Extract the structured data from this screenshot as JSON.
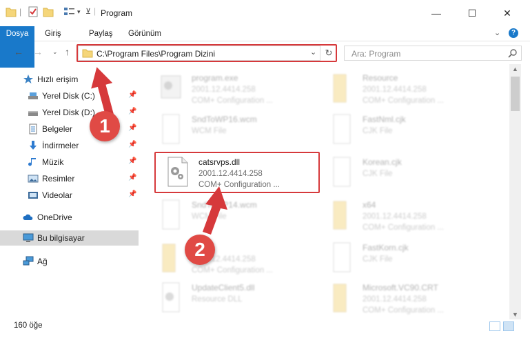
{
  "window": {
    "title": "Program",
    "controls": {
      "minimize": "—",
      "maximize": "☐",
      "close": "✕"
    }
  },
  "ribbon": {
    "tabs": [
      "Dosya",
      "Giriş",
      "Paylaş",
      "Görünüm"
    ],
    "accent": "#1979ca",
    "help_icon": "?"
  },
  "addressbar": {
    "path": "C:\\Program Files\\Program Dizini",
    "search_placeholder": "Ara: Program",
    "refresh_icon": "↻",
    "dropdown_icon": "⌄"
  },
  "sidebar": {
    "items": [
      {
        "label": "Hızlı erişim",
        "icon": "star-icon",
        "pinned": false
      },
      {
        "label": "Yerel Disk (C:)",
        "icon": "drive-icon",
        "pinned": true
      },
      {
        "label": "Yerel Disk (D:)",
        "icon": "drive-icon",
        "pinned": true
      },
      {
        "label": "Belgeler",
        "icon": "documents-icon",
        "pinned": true
      },
      {
        "label": "İndirmeler",
        "icon": "download-icon",
        "pinned": true
      },
      {
        "label": "Müzik",
        "icon": "music-icon",
        "pinned": true
      },
      {
        "label": "Resimler",
        "icon": "pictures-icon",
        "pinned": true
      },
      {
        "label": "Videolar",
        "icon": "videos-icon",
        "pinned": true
      },
      {
        "label": "OneDrive",
        "icon": "cloud-icon",
        "pinned": false
      },
      {
        "label": "Bu bilgisayar",
        "icon": "computer-icon",
        "pinned": false,
        "selected": true
      },
      {
        "label": "Ağ",
        "icon": "network-icon",
        "pinned": false
      }
    ]
  },
  "files": [
    {
      "name": "program.exe",
      "version": "2001.12.4414.258",
      "description": "COM+ Configuration ...",
      "type": "exe",
      "faded": true
    },
    {
      "name": "Resource",
      "version": "2001.12.4414.258",
      "description": "COM+ Configuration ...",
      "type": "folder",
      "faded": true
    },
    {
      "name": "SndToWP16.wcm",
      "version": "WCM File",
      "description": "",
      "type": "doc",
      "faded": true
    },
    {
      "name": "FastNml.cjk",
      "version": "CJK File",
      "description": "",
      "type": "doc",
      "faded": true
    },
    {
      "name": "catsrvps.dll",
      "version": "2001.12.4414.258",
      "description": "COM+ Configuration ...",
      "type": "dll",
      "faded": false
    },
    {
      "name": "Korean.cjk",
      "version": "CJK File",
      "description": "",
      "type": "doc",
      "faded": true
    },
    {
      "name": "SndToWP14.wcm",
      "version": "WCM File",
      "description": "",
      "type": "doc",
      "faded": true
    },
    {
      "name": "x64",
      "version": "2001.12.4414.258",
      "description": "COM+ Configuration ...",
      "type": "folder",
      "faded": true
    },
    {
      "name": "",
      "version": "2001.12.4414.258",
      "description": "COM+ Configuration ...",
      "type": "folder",
      "faded": true
    },
    {
      "name": "FastKorn.cjk",
      "version": "CJK File",
      "description": "",
      "type": "doc",
      "faded": true
    },
    {
      "name": "UpdateClient5.dll",
      "version": "Resource DLL",
      "description": "",
      "type": "dll",
      "faded": true
    },
    {
      "name": "Microsoft.VC90.CRT",
      "version": "2001.12.4414.258",
      "description": "COM+ Configuration ...",
      "type": "folder",
      "faded": true
    }
  ],
  "status": {
    "count": "160 öğe"
  },
  "annotations": {
    "step1": "1",
    "step2": "2",
    "color": "#d6393b"
  }
}
